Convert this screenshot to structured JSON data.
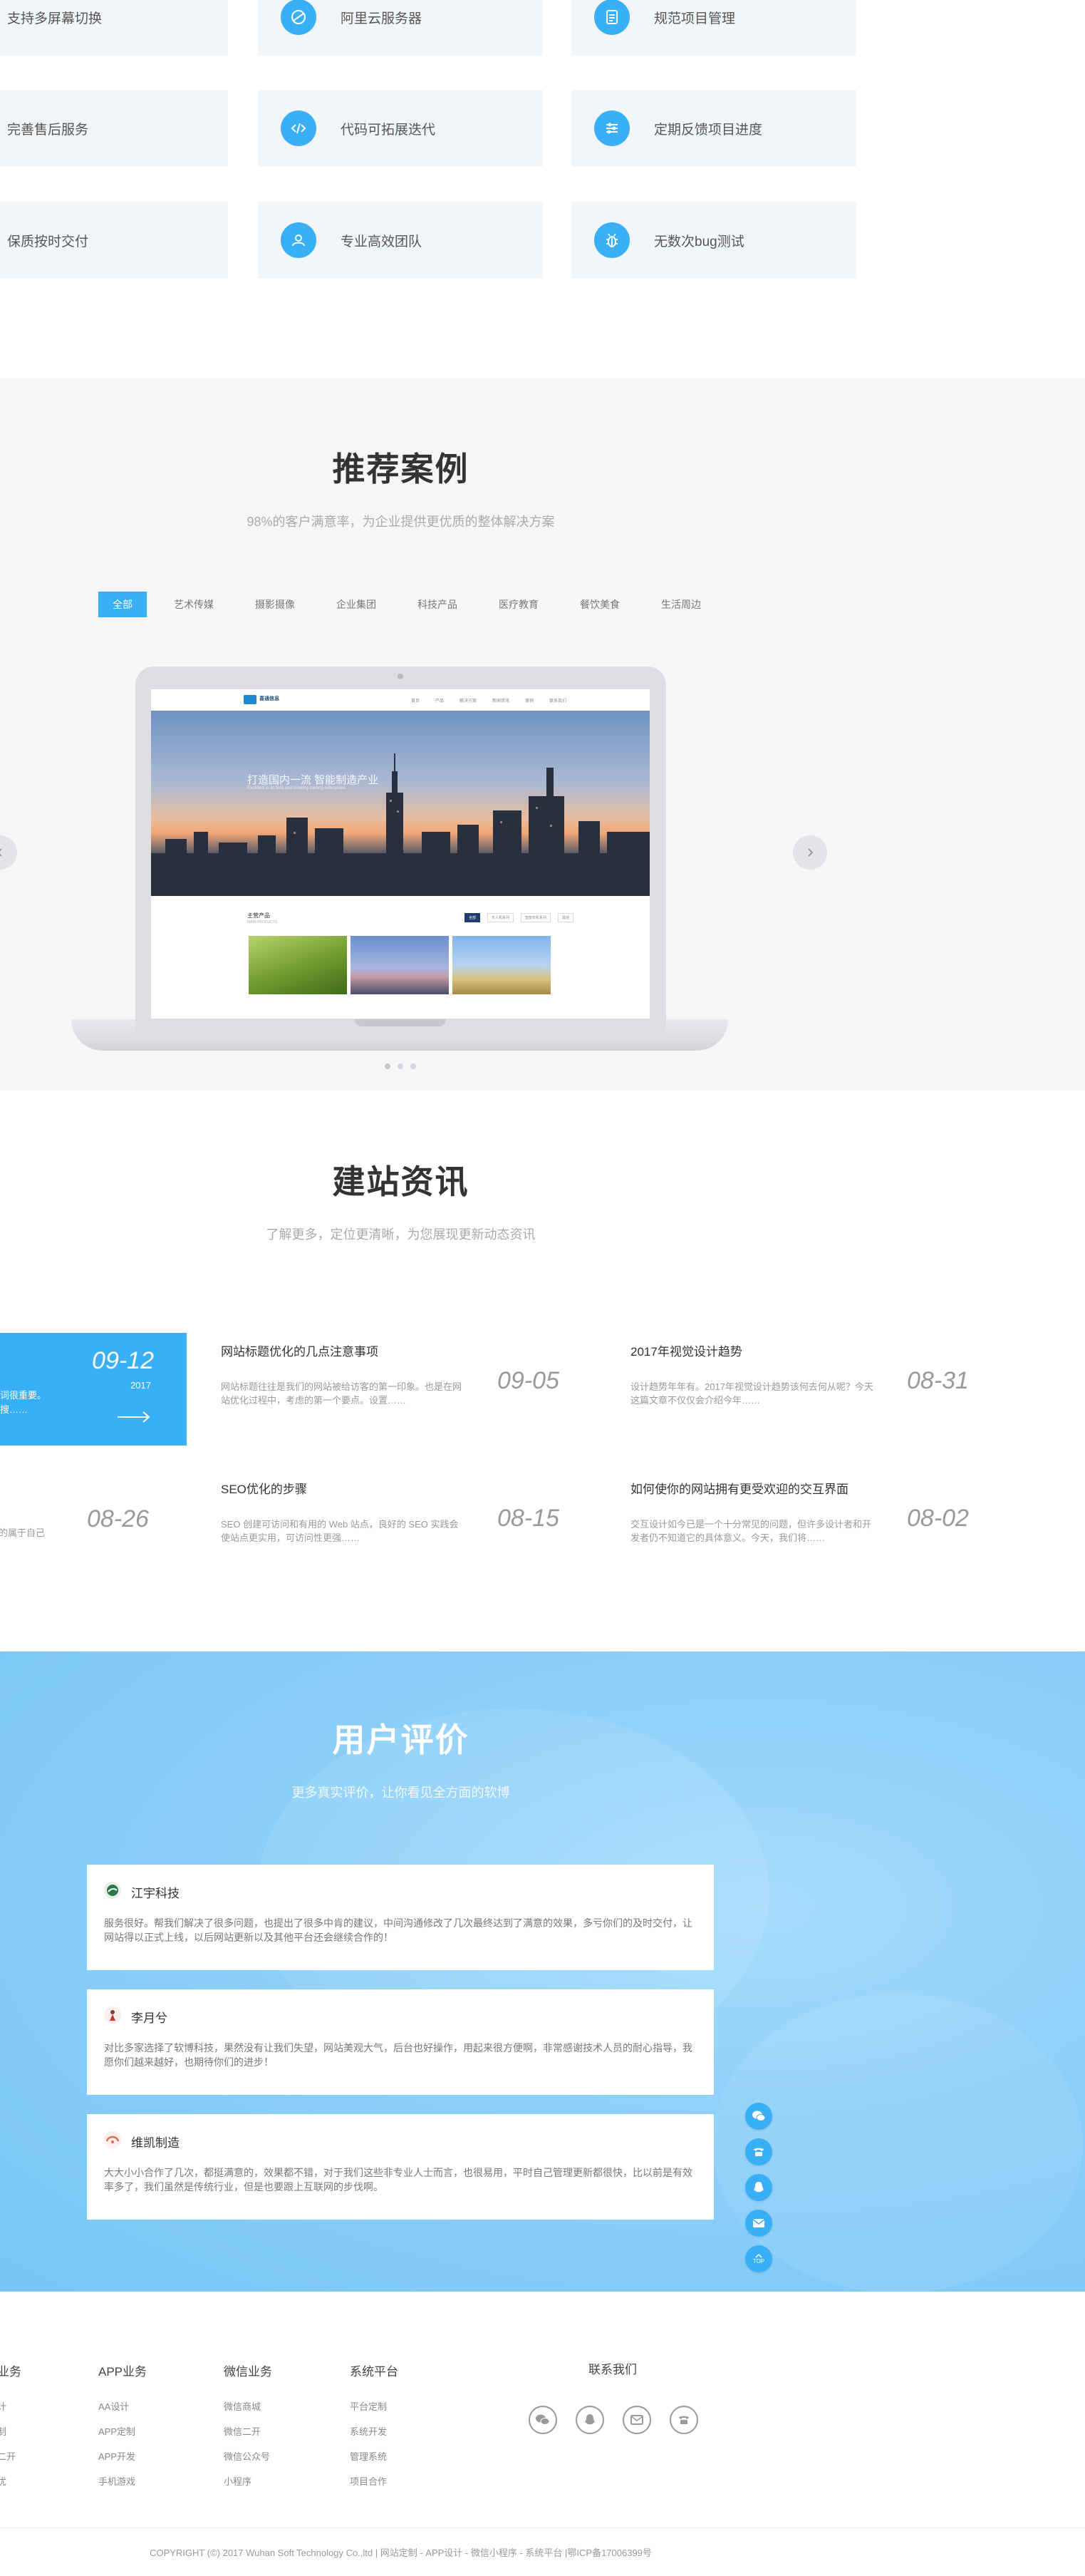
{
  "features": {
    "items": [
      {
        "label": "支持多屏幕切换",
        "icon": "none"
      },
      {
        "label": "阿里云服务器",
        "icon": "cloud-icon"
      },
      {
        "label": "规范项目管理",
        "icon": "document-icon"
      },
      {
        "label": "完善售后服务",
        "icon": "none"
      },
      {
        "label": "代码可拓展迭代",
        "icon": "code-icon"
      },
      {
        "label": "定期反馈项目进度",
        "icon": "sliders-icon"
      },
      {
        "label": "保质按时交付",
        "icon": "none"
      },
      {
        "label": "专业高效团队",
        "icon": "team-icon"
      },
      {
        "label": "无数次bug测试",
        "icon": "bug-icon"
      }
    ]
  },
  "cases": {
    "title": "推荐案例",
    "subtitle": "98%的客户满意率，为企业提供更优质的整体解决方案",
    "tabs": [
      "全部",
      "艺术传媒",
      "摄影摄像",
      "企业集团",
      "科技产品",
      "医疗教育",
      "餐饮美食",
      "生活周边"
    ],
    "active_tab": "全部",
    "mock": {
      "logo_text": "喜通信息",
      "nav_links": [
        "首页",
        "产品",
        "解决方案",
        "新闻资讯",
        "案例",
        "联系我们"
      ],
      "hero_title": "打造国内一流 智能制造产业",
      "hero_sub": "Excellent in its field and creating leading enterprises",
      "section_title": "主营产品",
      "section_sub": "MAIN PRODUCTS",
      "section_tabs": [
        "全部",
        "无人机系列",
        "智能农机系列",
        "其他"
      ]
    }
  },
  "news": {
    "title": "建站资讯",
    "subtitle": "了解更多，定位更清晰，为您展现更新动态资讯",
    "feature": {
      "date": "09-12",
      "year": "2017",
      "text": "词很重要。搜……"
    },
    "items": [
      {
        "title": "网站标题优化的几点注意事项",
        "desc": "网站标题往往是我们的网站被给访客的第一印象。也是在网站优化过程中，考虑的第一个要点。设置……",
        "date": "09-05"
      },
      {
        "title": "2017年视觉设计趋势",
        "desc": "设计趋势年年有。2017年视觉设计趋势该何去何从呢？今天这篇文章不仅仅会介绍今年……",
        "date": "08-31"
      },
      {
        "title": "SEO优化的步骤",
        "desc": "SEO 创建可访问和有用的 Web 站点，良好的 SEO 实践会使站点更实用，可访问性更强……",
        "date": "08-15"
      },
      {
        "title": "如何使你的网站拥有更受欢迎的交互界面",
        "desc": "交互设计如今已是一个十分常见的问题，但许多设计者和开发者仍不知道它的具体意义。今天，我们将……",
        "date": "08-02"
      }
    ],
    "left_fragment": {
      "text": "的属于自己",
      "date": "08-26"
    }
  },
  "reviews": {
    "title": "用户评价",
    "subtitle": "更多真实评价，让你看见全方面的软博",
    "items": [
      {
        "name": "江宇科技",
        "text": "服务很好。帮我们解决了很多问题，也提出了很多中肯的建议，中间沟通修改了几次最终达到了满意的效果，多亏你们的及时交付，让网站得以正式上线，以后网站更新以及其他平台还会继续合作的！"
      },
      {
        "name": "李月兮",
        "text": "对比多家选择了软博科技，果然没有让我们失望，网站美观大气，后台也好操作，用起来很方便啊，非常感谢技术人员的耐心指导，我愿你们越来越好，也期待你们的进步！"
      },
      {
        "name": "维凯制造",
        "text": "大大小小合作了几次，都挺满意的，效果都不错，对于我们这些非专业人士而言，也很易用，平时自己管理更新都很快，比以前是有效率多了，我们虽然是传统行业，但是也要跟上互联网的步伐啊。"
      }
    ],
    "side_buttons": [
      "wechat-icon",
      "phone-icon",
      "qq-icon",
      "mail-icon",
      "top-icon"
    ],
    "top_label": "TOP"
  },
  "footer": {
    "columns": [
      {
        "title": "业务",
        "links": [
          "计",
          "制",
          "二开",
          "优"
        ]
      },
      {
        "title": "APP业务",
        "links": [
          "AA设计",
          "APP定制",
          "APP开发",
          "手机游戏"
        ]
      },
      {
        "title": "微信业务",
        "links": [
          "微信商城",
          "微信二开",
          "微信公众号",
          "小程序"
        ]
      },
      {
        "title": "系统平台",
        "links": [
          "平台定制",
          "系统开发",
          "管理系统",
          "项目合作"
        ]
      }
    ],
    "contact_title": "联系我们",
    "contact_icons": [
      "wechat-icon",
      "qq-icon",
      "mail-icon",
      "phone-icon"
    ],
    "copyright": "COPYRIGHT (©) 2017 Wuhan Soft Technology Co.,ltd | 网站定制 - APP设计 - 微信小程序 - 系统平台 |鄂ICP备17006399号"
  },
  "colors": {
    "accent": "#38aff7",
    "feature_bg": "#f3f6f9",
    "section_bg": "#f5f6f8",
    "reviews_bg": "#8dd0f9"
  }
}
